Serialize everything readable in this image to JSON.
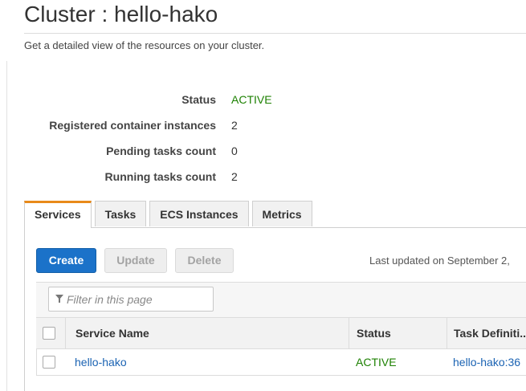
{
  "page": {
    "title": "Cluster : hello-hako",
    "subtitle": "Get a detailed view of the resources on your cluster."
  },
  "details": [
    {
      "label": "Status",
      "value": "ACTIVE"
    },
    {
      "label": "Registered container instances",
      "value": "2"
    },
    {
      "label": "Pending tasks count",
      "value": "0"
    },
    {
      "label": "Running tasks count",
      "value": "2"
    }
  ],
  "tabs": [
    {
      "label": "Services",
      "active": true
    },
    {
      "label": "Tasks",
      "active": false
    },
    {
      "label": "ECS Instances",
      "active": false
    },
    {
      "label": "Metrics",
      "active": false
    }
  ],
  "toolbar": {
    "create_label": "Create",
    "update_label": "Update",
    "delete_label": "Delete",
    "last_updated": "Last updated on September 2,"
  },
  "filter": {
    "placeholder": "Filter in this page",
    "icon": "filter-icon"
  },
  "table": {
    "columns": [
      "Service Name",
      "Status",
      "Task Definiti..."
    ],
    "rows": [
      {
        "service_name": "hello-hako",
        "status": "ACTIVE",
        "task_definition": "hello-hako:36"
      }
    ]
  },
  "colors": {
    "primary_button": "#1b72c9",
    "active_status": "#1d8102",
    "link": "#1b63b3",
    "active_tab_accent": "#e88a1a"
  }
}
